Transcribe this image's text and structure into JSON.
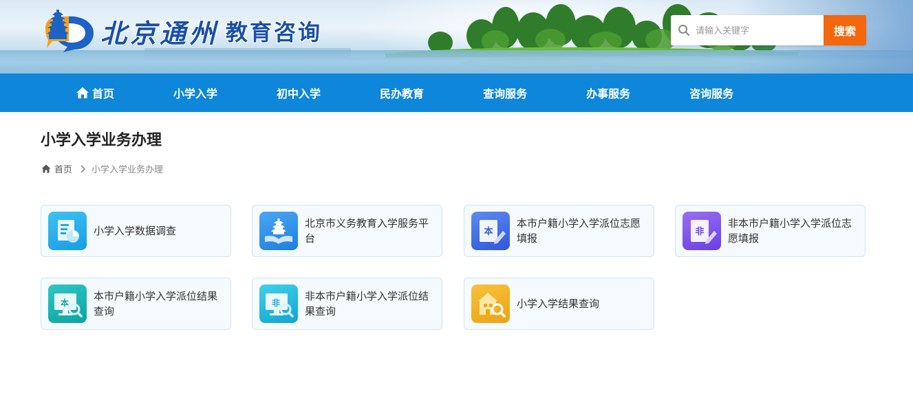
{
  "header": {
    "logo_text_script": "北京通州",
    "logo_text_main": "教育咨询",
    "search": {
      "placeholder": "请输入关键字",
      "button_label": "搜索"
    }
  },
  "nav": {
    "items": [
      {
        "label": "首页",
        "icon": "home-icon"
      },
      {
        "label": "小学入学"
      },
      {
        "label": "初中入学"
      },
      {
        "label": "民办教育"
      },
      {
        "label": "查询服务"
      },
      {
        "label": "办事服务"
      },
      {
        "label": "咨询服务"
      }
    ]
  },
  "page": {
    "title": "小学入学业务办理",
    "breadcrumb": {
      "home": "首页",
      "current": "小学入学业务办理"
    }
  },
  "cards": [
    {
      "label": "小学入学数据调查",
      "icon": "document-chart-icon",
      "color": "#22a9ea"
    },
    {
      "label": "北京市义务教育入学服务平台",
      "icon": "pagoda-book-icon",
      "color": "#2f8fe8"
    },
    {
      "label": "本市户籍小学入学派位志愿填报",
      "icon": "edit-form-icon",
      "color": "#3f6fe6",
      "glyph": "本"
    },
    {
      "label": "非本市户籍小学入学派位志愿填报",
      "icon": "edit-form-icon",
      "color": "#7b55e8",
      "glyph": "非"
    },
    {
      "label": "本市户籍小学入学派位结果查询",
      "icon": "monitor-search-icon",
      "color": "#14b3b0",
      "glyph": "本"
    },
    {
      "label": "非本市户籍小学入学派位结果查询",
      "icon": "monitor-search-icon",
      "color": "#1fb3d8",
      "glyph": "非"
    },
    {
      "label": "小学入学结果查询",
      "icon": "school-search-icon",
      "color": "#f0a91c"
    }
  ],
  "colors": {
    "nav_bg": "#0e86d9",
    "search_button": "#f4670c",
    "title_blue": "#1a50a8"
  }
}
